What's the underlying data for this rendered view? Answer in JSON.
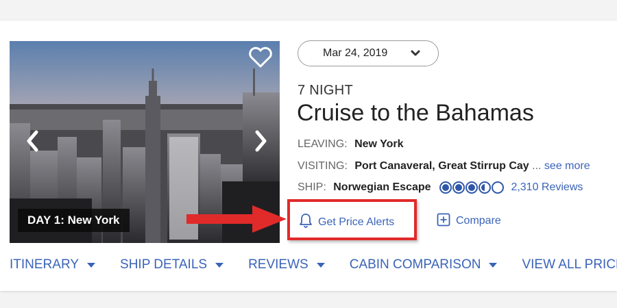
{
  "hero": {
    "day_label": "DAY 1: New York"
  },
  "date_select": {
    "value": "Mar 24, 2019"
  },
  "cruise": {
    "nights": "7 NIGHT",
    "title": "Cruise to the Bahamas",
    "leaving_label": "LEAVING:",
    "leaving_value": "New York",
    "visiting_label": "VISITING:",
    "visiting_value": "Port Canaveral, Great Stirrup Cay",
    "visiting_ellipsis": "...",
    "see_more": "see more",
    "ship_label": "SHIP:",
    "ship_value": "Norwegian Escape",
    "rating": 3.5,
    "rating_max": 5,
    "reviews": "2,310 Reviews"
  },
  "actions": {
    "price_alerts": "Get Price Alerts",
    "compare": "Compare"
  },
  "tabs": [
    {
      "label": "ITINERARY"
    },
    {
      "label": "SHIP DETAILS"
    },
    {
      "label": "REVIEWS"
    },
    {
      "label": "CABIN COMPARISON"
    },
    {
      "label": "VIEW ALL PRICES"
    }
  ],
  "colors": {
    "link": "#3a63b8",
    "highlight": "#e12a2a"
  }
}
